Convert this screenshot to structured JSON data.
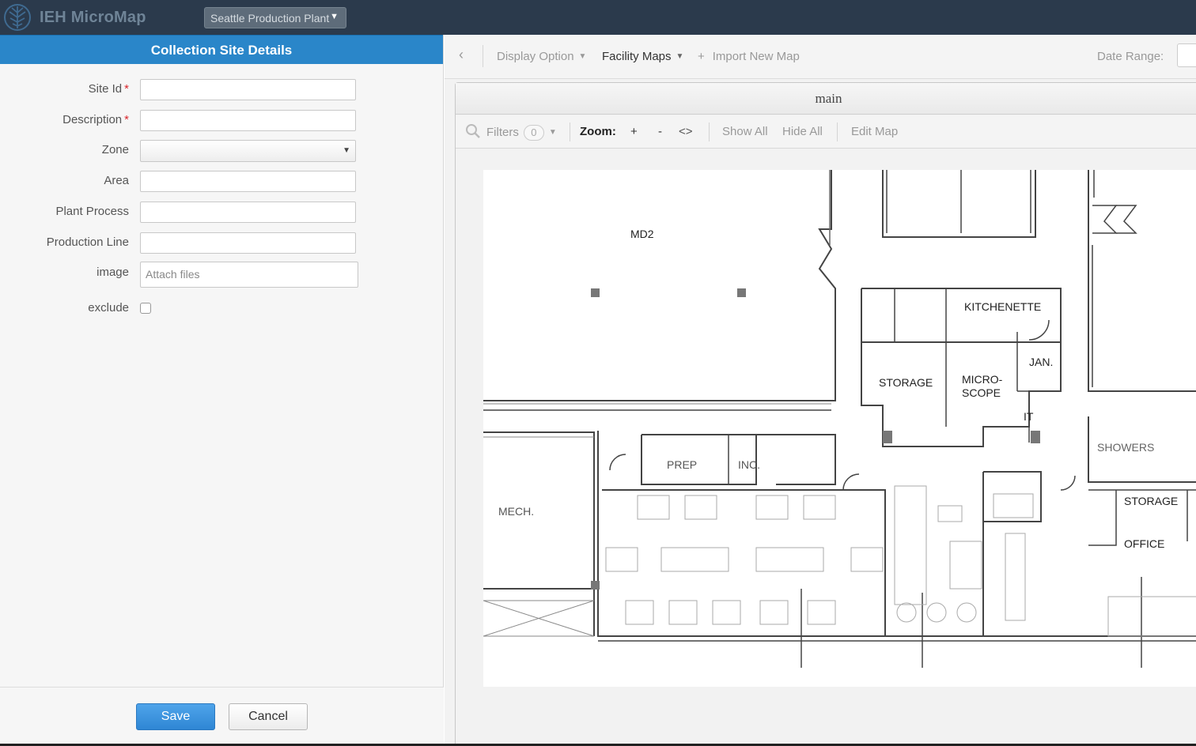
{
  "app": {
    "name": "IEH MicroMap",
    "plant_selector": "Seattle Production Plant"
  },
  "form": {
    "header": "Collection Site Details",
    "required_mark": "*",
    "fields": {
      "site_id": "Site Id",
      "description": "Description",
      "zone": "Zone",
      "area": "Area",
      "plant_process": "Plant Process",
      "production_line": "Production Line",
      "image": "image",
      "exclude": "exclude"
    },
    "attach_placeholder": "Attach files",
    "save": "Save",
    "cancel": "Cancel"
  },
  "toolbar": {
    "display_option": "Display Option",
    "facility_maps": "Facility Maps",
    "import_new_map": "Import New Map",
    "date_range": "Date Range:"
  },
  "map": {
    "title": "main",
    "filters": "Filters",
    "filters_count": "0",
    "zoom": "Zoom:",
    "zoom_in": "+",
    "zoom_out": "-",
    "pan": "<>",
    "show_all": "Show All",
    "hide_all": "Hide All",
    "edit_map": "Edit Map",
    "rooms": {
      "md2": "MD2",
      "kitchenette": "KITCHENETTE",
      "jan": "JAN.",
      "storage1": "STORAGE",
      "micro1": "MICRO-",
      "micro2": "SCOPE",
      "it": "IT",
      "showers": "SHOWERS",
      "prep": "PREP",
      "inc": "INC.",
      "mech": "MECH.",
      "storage2": "STORAGE",
      "office": "OFFICE"
    }
  }
}
